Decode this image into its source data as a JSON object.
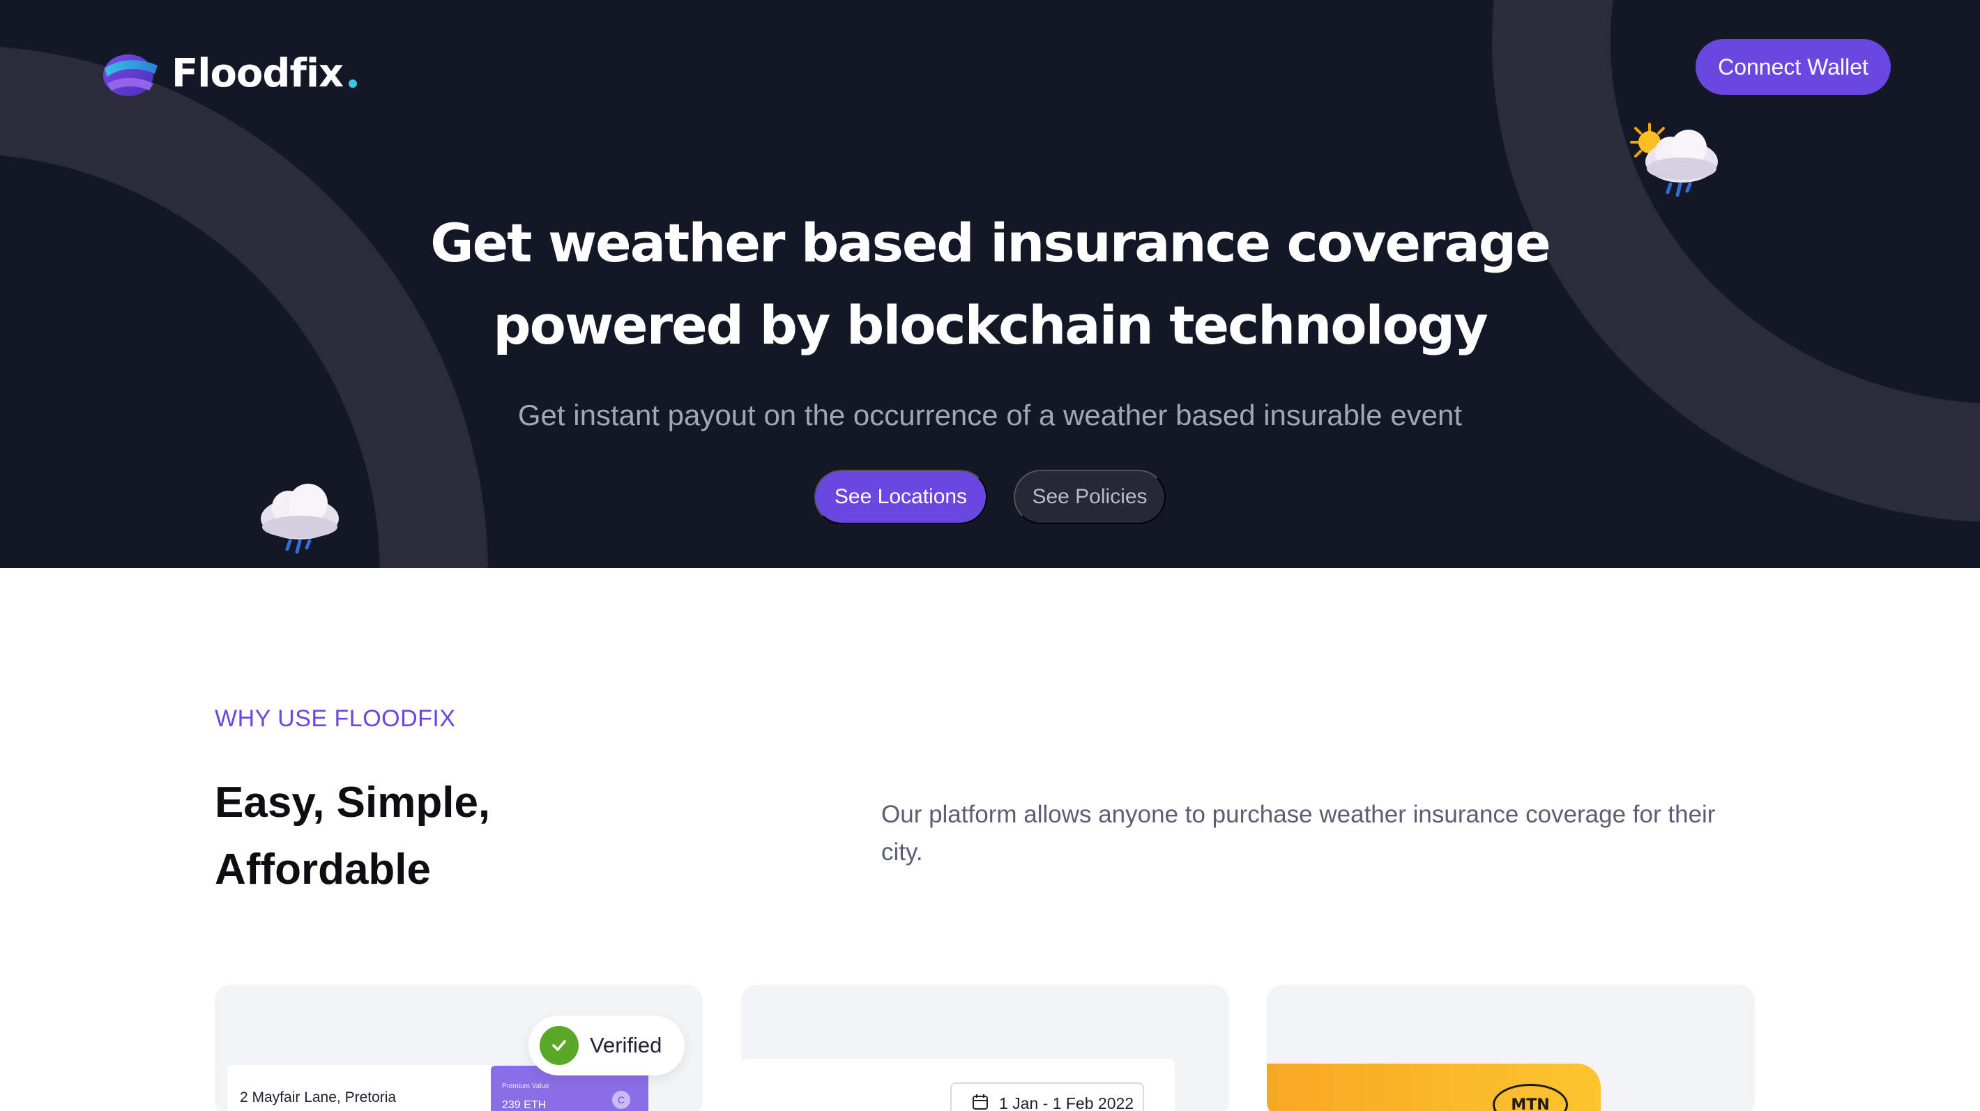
{
  "brand": {
    "name": "Floodfix",
    "accent": "#6a47e0",
    "dot_color": "#3cc7e4"
  },
  "header": {
    "connect_label": "Connect Wallet"
  },
  "hero": {
    "title_line1": "Get weather based insurance coverage",
    "title_line2": "powered by blockchain technology",
    "subtitle": "Get instant payout on the occurrence of a weather based insurable event",
    "primary_label": "See Locations",
    "secondary_label": "See Policies",
    "icons": [
      "sun-cloud-rain-icon",
      "cloud-rain-icon"
    ]
  },
  "why": {
    "label": "WHY USE FLOODFIX",
    "title_line1": "Easy, Simple,",
    "title_line2": "Affordable",
    "description": "Our platform allows anyone to purchase weather insurance coverage for their city."
  },
  "cards": {
    "card1": {
      "address": "2 Mayfair Lane, Pretoria",
      "premium_label": "Premium Value",
      "premium_value": "239 ETH",
      "badge": "C",
      "verified_label": "Verified"
    },
    "card2": {
      "date_range": "1 Jan - 1 Feb 2022",
      "icon": "calendar-icon"
    },
    "card3": {
      "logo_text": "MTN"
    }
  }
}
